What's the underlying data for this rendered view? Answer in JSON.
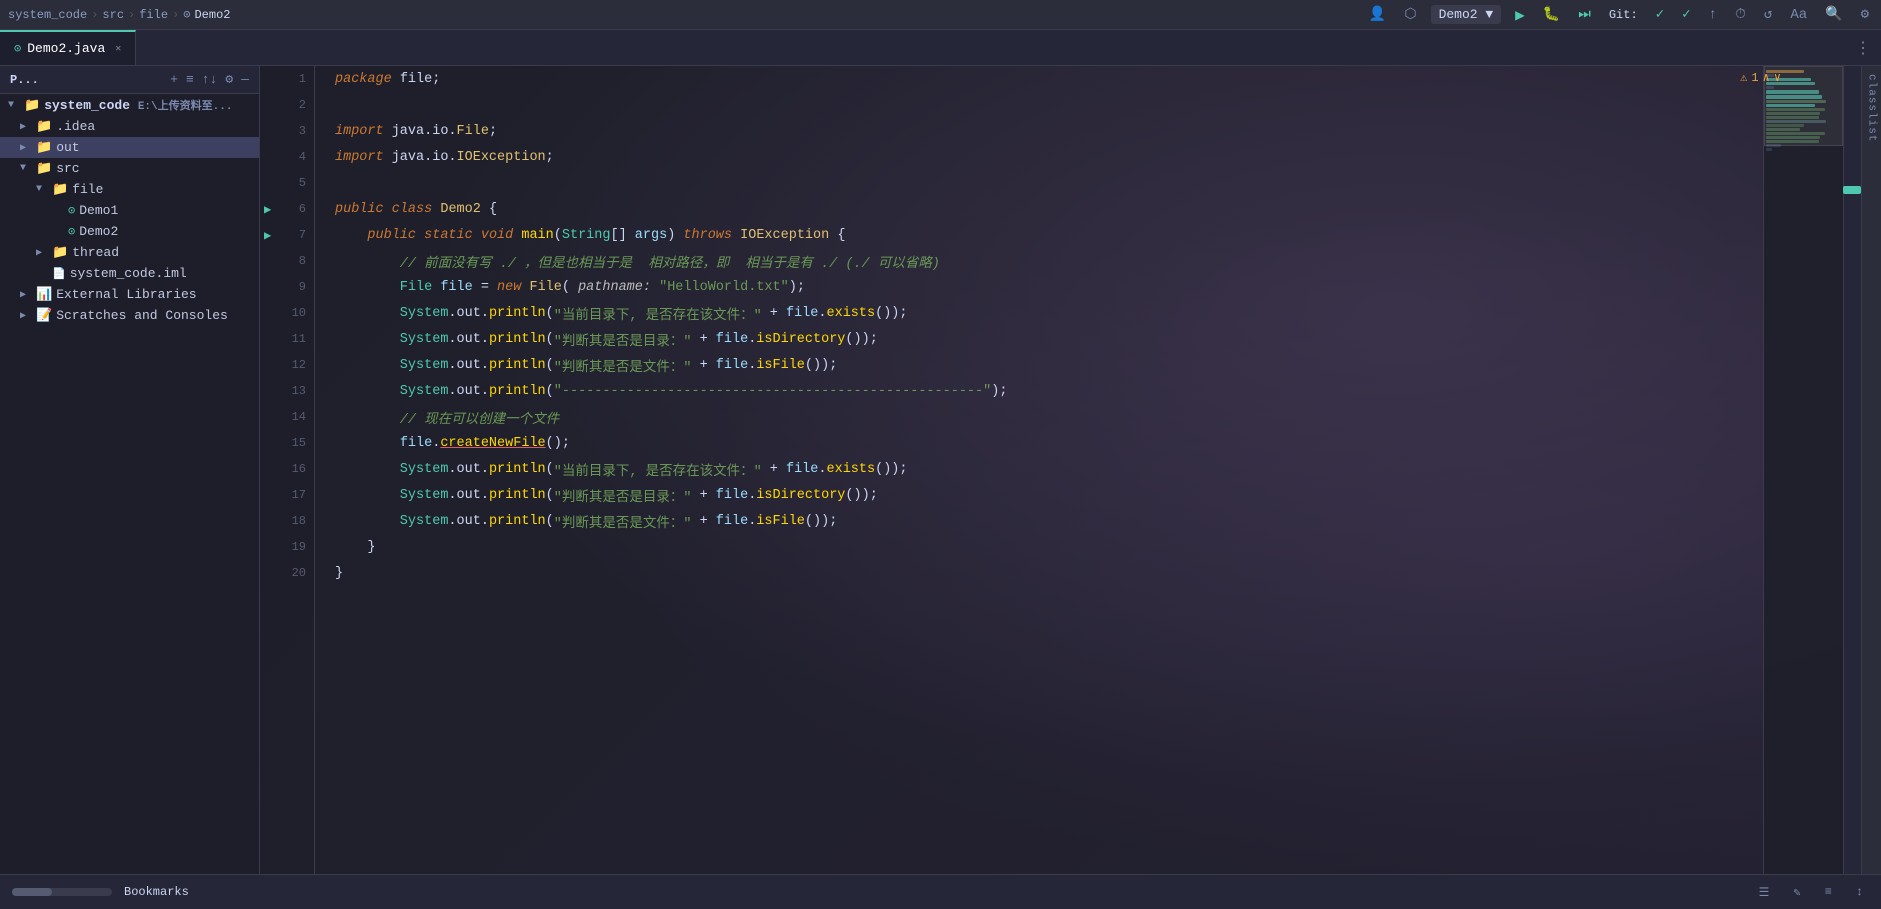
{
  "topbar": {
    "breadcrumb": [
      "system_code",
      "src",
      "file",
      "Demo2"
    ],
    "separators": [
      ">",
      ">",
      ">"
    ],
    "run_config": "Demo2",
    "git_label": "Git:",
    "warning_count": "1"
  },
  "tabs": [
    {
      "label": "Demo2.java",
      "active": true,
      "icon": "java"
    }
  ],
  "sidebar": {
    "title": "P...",
    "header_icons": [
      "+",
      "≡",
      "↑↓",
      "⚙",
      "—"
    ],
    "tree": [
      {
        "label": "system_code  E:\\上传资料至...",
        "level": 0,
        "type": "root",
        "expanded": true
      },
      {
        "label": ".idea",
        "level": 1,
        "type": "folder",
        "expanded": false
      },
      {
        "label": "out",
        "level": 1,
        "type": "folder-red",
        "expanded": false,
        "selected": true
      },
      {
        "label": "src",
        "level": 1,
        "type": "folder",
        "expanded": true
      },
      {
        "label": "file",
        "level": 2,
        "type": "folder",
        "expanded": true
      },
      {
        "label": "Demo1",
        "level": 3,
        "type": "java"
      },
      {
        "label": "Demo2",
        "level": 3,
        "type": "java"
      },
      {
        "label": "thread",
        "level": 2,
        "type": "folder",
        "expanded": false
      },
      {
        "label": "system_code.iml",
        "level": 2,
        "type": "iml"
      },
      {
        "label": "External Libraries",
        "level": 1,
        "type": "library",
        "expanded": false
      },
      {
        "label": "Scratches and Consoles",
        "level": 1,
        "type": "scratch",
        "expanded": false
      }
    ]
  },
  "code": {
    "filename": "Demo2.java",
    "lines": [
      {
        "num": 1,
        "content": "package file;",
        "tokens": [
          {
            "t": "kw",
            "v": "package"
          },
          {
            "t": "plain",
            "v": " file;"
          }
        ]
      },
      {
        "num": 2,
        "content": "",
        "tokens": []
      },
      {
        "num": 3,
        "content": "import java.io.File;",
        "tokens": [
          {
            "t": "kw",
            "v": "import"
          },
          {
            "t": "plain",
            "v": " java.io."
          },
          {
            "t": "cls",
            "v": "File"
          },
          {
            "t": "plain",
            "v": ";"
          }
        ]
      },
      {
        "num": 4,
        "content": "import java.io.IOException;",
        "tokens": [
          {
            "t": "kw",
            "v": "import"
          },
          {
            "t": "plain",
            "v": " java.io."
          },
          {
            "t": "cls",
            "v": "IOException"
          },
          {
            "t": "plain",
            "v": ";"
          }
        ]
      },
      {
        "num": 5,
        "content": "",
        "tokens": []
      },
      {
        "num": 6,
        "content": "public class Demo2 {",
        "tokens": [
          {
            "t": "kw",
            "v": "public"
          },
          {
            "t": "plain",
            "v": " "
          },
          {
            "t": "kw",
            "v": "class"
          },
          {
            "t": "plain",
            "v": " "
          },
          {
            "t": "cls",
            "v": "Demo2"
          },
          {
            "t": "plain",
            "v": " {"
          }
        ],
        "has_arrow": true
      },
      {
        "num": 7,
        "content": "    public static void main(String[] args) throws IOException {",
        "tokens": [
          {
            "t": "kw",
            "v": "public"
          },
          {
            "t": "plain",
            "v": " "
          },
          {
            "t": "kw",
            "v": "static"
          },
          {
            "t": "plain",
            "v": " "
          },
          {
            "t": "kw",
            "v": "void"
          },
          {
            "t": "plain",
            "v": " "
          },
          {
            "t": "fn",
            "v": "main"
          },
          {
            "t": "plain",
            "v": "("
          },
          {
            "t": "type",
            "v": "String"
          },
          {
            "t": "plain",
            "v": "[] "
          },
          {
            "t": "var",
            "v": "args"
          },
          {
            "t": "plain",
            "v": ") "
          },
          {
            "t": "kw",
            "v": "throws"
          },
          {
            "t": "plain",
            "v": " "
          },
          {
            "t": "cls",
            "v": "IOException"
          },
          {
            "t": "plain",
            "v": " {"
          }
        ],
        "has_arrow": true
      },
      {
        "num": 8,
        "content": "        // 前面没有写 ./ ，但是也相当于是  相对路径，即  相当于是有 ./ (./ 可以省略)",
        "tokens": [
          {
            "t": "cmt",
            "v": "        // 前面没有写 ./ ，但是也相当于是  相对路径，即  相当于是有 ./ (./ 可以省略)"
          }
        ]
      },
      {
        "num": 9,
        "content": "        File file = new File( pathname: \"HelloWorld.txt\");",
        "tokens": [
          {
            "t": "type",
            "v": "        File"
          },
          {
            "t": "plain",
            "v": " "
          },
          {
            "t": "var",
            "v": "file"
          },
          {
            "t": "plain",
            "v": " = "
          },
          {
            "t": "kw",
            "v": "new"
          },
          {
            "t": "plain",
            "v": " "
          },
          {
            "t": "cls",
            "v": "File"
          },
          {
            "t": "plain",
            "v": "( "
          },
          {
            "t": "annot",
            "v": "pathname:"
          },
          {
            "t": "plain",
            "v": " "
          },
          {
            "t": "str",
            "v": "\"HelloWorld.txt\""
          },
          {
            "t": "plain",
            "v": ");"
          }
        ]
      },
      {
        "num": 10,
        "content": "        System.out.println(\"当前目录下, 是否存在该文件：\" + file.exists());",
        "tokens": [
          {
            "t": "plain",
            "v": "        "
          },
          {
            "t": "type",
            "v": "System"
          },
          {
            "t": "plain",
            "v": ".out."
          },
          {
            "t": "fn",
            "v": "println"
          },
          {
            "t": "plain",
            "v": "("
          },
          {
            "t": "str",
            "v": "\"当前目录下, 是否存在该文件：\""
          },
          {
            "t": "plain",
            "v": " + "
          },
          {
            "t": "var",
            "v": "file"
          },
          {
            "t": "plain",
            "v": "."
          },
          {
            "t": "fn",
            "v": "exists"
          },
          {
            "t": "plain",
            "v": "());"
          }
        ]
      },
      {
        "num": 11,
        "content": "        System.out.println(\"判断其是否是目录：\" + file.isDirectory());",
        "tokens": [
          {
            "t": "plain",
            "v": "        "
          },
          {
            "t": "type",
            "v": "System"
          },
          {
            "t": "plain",
            "v": ".out."
          },
          {
            "t": "fn",
            "v": "println"
          },
          {
            "t": "plain",
            "v": "("
          },
          {
            "t": "str",
            "v": "\"判断其是否是目录：\""
          },
          {
            "t": "plain",
            "v": " + "
          },
          {
            "t": "var",
            "v": "file"
          },
          {
            "t": "plain",
            "v": "."
          },
          {
            "t": "fn",
            "v": "isDirectory"
          },
          {
            "t": "plain",
            "v": "());"
          }
        ]
      },
      {
        "num": 12,
        "content": "        System.out.println(\"判断其是否是文件：\" + file.isFile());",
        "tokens": [
          {
            "t": "plain",
            "v": "        "
          },
          {
            "t": "type",
            "v": "System"
          },
          {
            "t": "plain",
            "v": ".out."
          },
          {
            "t": "fn",
            "v": "println"
          },
          {
            "t": "plain",
            "v": "("
          },
          {
            "t": "str",
            "v": "\"判断其是否是文件：\""
          },
          {
            "t": "plain",
            "v": " + "
          },
          {
            "t": "var",
            "v": "file"
          },
          {
            "t": "plain",
            "v": "."
          },
          {
            "t": "fn",
            "v": "isFile"
          },
          {
            "t": "plain",
            "v": "());"
          }
        ]
      },
      {
        "num": 13,
        "content": "        System.out.println(\"----------------------------------------------------\");",
        "tokens": [
          {
            "t": "plain",
            "v": "        "
          },
          {
            "t": "type",
            "v": "System"
          },
          {
            "t": "plain",
            "v": ".out."
          },
          {
            "t": "fn",
            "v": "println"
          },
          {
            "t": "plain",
            "v": "("
          },
          {
            "t": "str",
            "v": "\"----------------------------------------------------\""
          },
          {
            "t": "plain",
            "v": ");"
          }
        ]
      },
      {
        "num": 14,
        "content": "        // 现在可以创建一个文件",
        "tokens": [
          {
            "t": "cmt",
            "v": "        // 现在可以创建一个文件"
          }
        ]
      },
      {
        "num": 15,
        "content": "        file.createNewFile();",
        "tokens": [
          {
            "t": "plain",
            "v": "        "
          },
          {
            "t": "var",
            "v": "file"
          },
          {
            "t": "plain",
            "v": "."
          },
          {
            "t": "fn underline",
            "v": "createNewFile"
          },
          {
            "t": "plain",
            "v": "();"
          }
        ]
      },
      {
        "num": 16,
        "content": "        System.out.println(\"当前目录下, 是否存在该文件：\" + file.exists());",
        "tokens": [
          {
            "t": "plain",
            "v": "        "
          },
          {
            "t": "type",
            "v": "System"
          },
          {
            "t": "plain",
            "v": ".out."
          },
          {
            "t": "fn",
            "v": "println"
          },
          {
            "t": "plain",
            "v": "("
          },
          {
            "t": "str",
            "v": "\"当前目录下, 是否存在该文件：\""
          },
          {
            "t": "plain",
            "v": " + "
          },
          {
            "t": "var",
            "v": "file"
          },
          {
            "t": "plain",
            "v": "."
          },
          {
            "t": "fn",
            "v": "exists"
          },
          {
            "t": "plain",
            "v": "());"
          }
        ]
      },
      {
        "num": 17,
        "content": "        System.out.println(\"判断其是否是目录：\" + file.isDirectory());",
        "tokens": [
          {
            "t": "plain",
            "v": "        "
          },
          {
            "t": "type",
            "v": "System"
          },
          {
            "t": "plain",
            "v": ".out."
          },
          {
            "t": "fn",
            "v": "println"
          },
          {
            "t": "plain",
            "v": "("
          },
          {
            "t": "str",
            "v": "\"判断其是否是目录：\""
          },
          {
            "t": "plain",
            "v": " + "
          },
          {
            "t": "var",
            "v": "file"
          },
          {
            "t": "plain",
            "v": "."
          },
          {
            "t": "fn",
            "v": "isDirectory"
          },
          {
            "t": "plain",
            "v": "());"
          }
        ]
      },
      {
        "num": 18,
        "content": "        System.out.println(\"判断其是否是文件：\" + file.isFile());",
        "tokens": [
          {
            "t": "plain",
            "v": "        "
          },
          {
            "t": "type",
            "v": "System"
          },
          {
            "t": "plain",
            "v": ".out."
          },
          {
            "t": "fn",
            "v": "println"
          },
          {
            "t": "plain",
            "v": "("
          },
          {
            "t": "str",
            "v": "\"判断其是否是文件：\""
          },
          {
            "t": "plain",
            "v": " + "
          },
          {
            "t": "var",
            "v": "file"
          },
          {
            "t": "plain",
            "v": "."
          },
          {
            "t": "fn",
            "v": "isFile"
          },
          {
            "t": "plain",
            "v": "());"
          }
        ]
      },
      {
        "num": 19,
        "content": "    }",
        "tokens": [
          {
            "t": "plain",
            "v": "    }"
          }
        ]
      },
      {
        "num": 20,
        "content": "}",
        "tokens": [
          {
            "t": "plain",
            "v": "}"
          }
        ]
      }
    ]
  },
  "bottom_bar": {
    "bookmark_label": "Bookmarks",
    "icons": [
      "☰",
      "✎",
      "≡",
      "↕"
    ]
  },
  "classlist": {
    "label": "classlist"
  }
}
